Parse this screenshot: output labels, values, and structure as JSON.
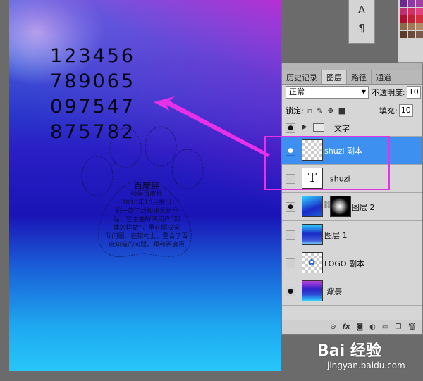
{
  "canvas": {
    "numbers": [
      "123456",
      "789065",
      "097547",
      "875782"
    ],
    "paw_logo": {
      "title": "百度经",
      "lines": [
        "验是百度推",
        "2010年10月推出",
        "的一款生活知识系新产",
        "品，它主要解决用户“到",
        "体怎样做”，重在解决实",
        "际问题。在架构上，整合了百",
        "度知道的问题，跟和百度百"
      ]
    }
  },
  "character_panel": {
    "buttons": [
      {
        "label": "A",
        "icon": "text-a-icon"
      },
      {
        "label": "¶",
        "icon": "paragraph-icon"
      }
    ]
  },
  "swatches_panel": {
    "colors": [
      "#6a2a8a",
      "#8a3aa0",
      "#a040a0",
      "#c03070",
      "#d03060",
      "#e04080",
      "#b01030",
      "#c02030",
      "#d03040",
      "#8a6a4a",
      "#a07a5a",
      "#b08a6a",
      "#5a3a2a",
      "#6a4a3a",
      "#7a5a4a"
    ]
  },
  "layers_panel": {
    "tabs": [
      {
        "label": "历史记录",
        "active": false
      },
      {
        "label": "图层",
        "active": true
      },
      {
        "label": "路径",
        "active": false
      },
      {
        "label": "通道",
        "active": false
      }
    ],
    "blend_mode": "正常",
    "opacity_label": "不透明度:",
    "opacity_value": "10",
    "lock_label": "锁定:",
    "fill_label": "填充:",
    "fill_value": "10",
    "layers": [
      {
        "name": "文字",
        "type": "group",
        "visible": true,
        "selected": false
      },
      {
        "name": "shuzi 副本",
        "type": "raster-transparent",
        "visible": true,
        "selected": true
      },
      {
        "name": "shuzi",
        "type": "text",
        "visible": false,
        "selected": false
      },
      {
        "name": "图层 2",
        "type": "raster-mask",
        "visible": true,
        "selected": false
      },
      {
        "name": "图层 1",
        "type": "raster-gradient",
        "visible": false,
        "selected": false
      },
      {
        "name": "LOGO 副本",
        "type": "raster-transparent",
        "visible": false,
        "selected": false
      },
      {
        "name": "背景",
        "type": "background",
        "visible": true,
        "selected": false
      }
    ],
    "bottom_icons": [
      "link-icon",
      "fx-icon",
      "mask-icon",
      "adjustment-icon",
      "new-group-icon",
      "new-layer-icon",
      "trash-icon"
    ]
  },
  "annotation": {
    "color": "#e830e8"
  },
  "watermark": {
    "brand": "Bai 经验",
    "url": "jingyan.baidu.com"
  }
}
